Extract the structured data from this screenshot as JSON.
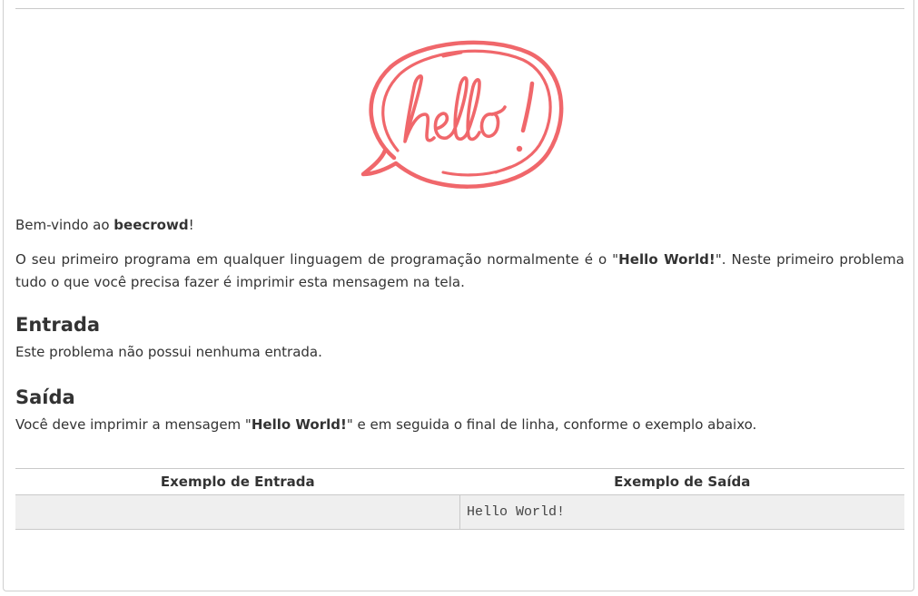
{
  "logo": {
    "text": "hello!",
    "icon": "hello-speech-bubble-icon",
    "color": "#f0676b"
  },
  "welcome": {
    "prefix": "Bem-vindo ao ",
    "brand": "beecrowd",
    "suffix": "!"
  },
  "intro": {
    "part1": "O seu primeiro programa em qualquer linguagem de programação normalmente é o \"",
    "highlight": "Hello World!",
    "part2": "\". Neste primeiro problema tudo o que você precisa fazer é imprimir esta mensagem na tela."
  },
  "input_section": {
    "title": "Entrada",
    "text": "Este problema não possui nenhuma entrada."
  },
  "output_section": {
    "title": "Saída",
    "part1": "Você deve imprimir a mensagem \"",
    "highlight": "Hello World!",
    "part2": "\" e em seguida o final de linha, conforme o exemplo abaixo."
  },
  "examples": {
    "input_header": "Exemplo de Entrada",
    "output_header": "Exemplo de Saída",
    "input_value": "",
    "output_value": "Hello World!"
  },
  "colors": {
    "text": "#333333",
    "accent": "#f0676b",
    "table_cell_bg": "#efefef",
    "border": "#c9c9c9"
  }
}
